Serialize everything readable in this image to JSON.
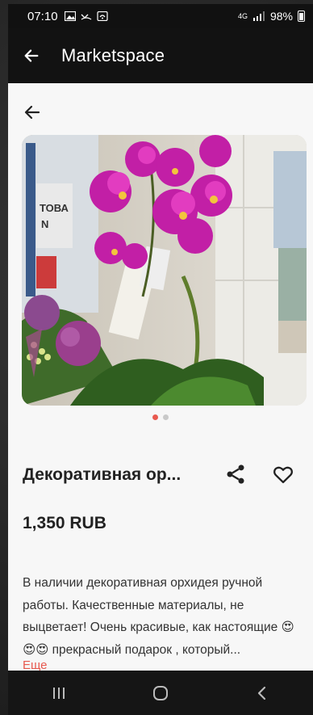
{
  "status_bar": {
    "time": "07:10",
    "network": "4G",
    "battery": "98%"
  },
  "app_bar": {
    "title": "Marketspace"
  },
  "product": {
    "title": "Декоративная ор...",
    "price": "1,350 RUB",
    "description": "В наличии декоративная орхидея ручной работы. Качественные материалы, не выцветает! Очень красивые, как настоящие 😍😍😍 прекрасный подарок , который...",
    "more_label": "Еще"
  },
  "gallery": {
    "image_count": 2,
    "active_index": 0
  },
  "colors": {
    "accent": "#e8594f",
    "app_bar": "#121212",
    "background": "#f7f7f7"
  },
  "icons": {
    "back": "arrow-left-icon",
    "share": "share-icon",
    "favorite": "heart-outline-icon",
    "nav_recent": "recent-apps-icon",
    "nav_home": "home-icon",
    "nav_back": "chevron-left-icon"
  }
}
